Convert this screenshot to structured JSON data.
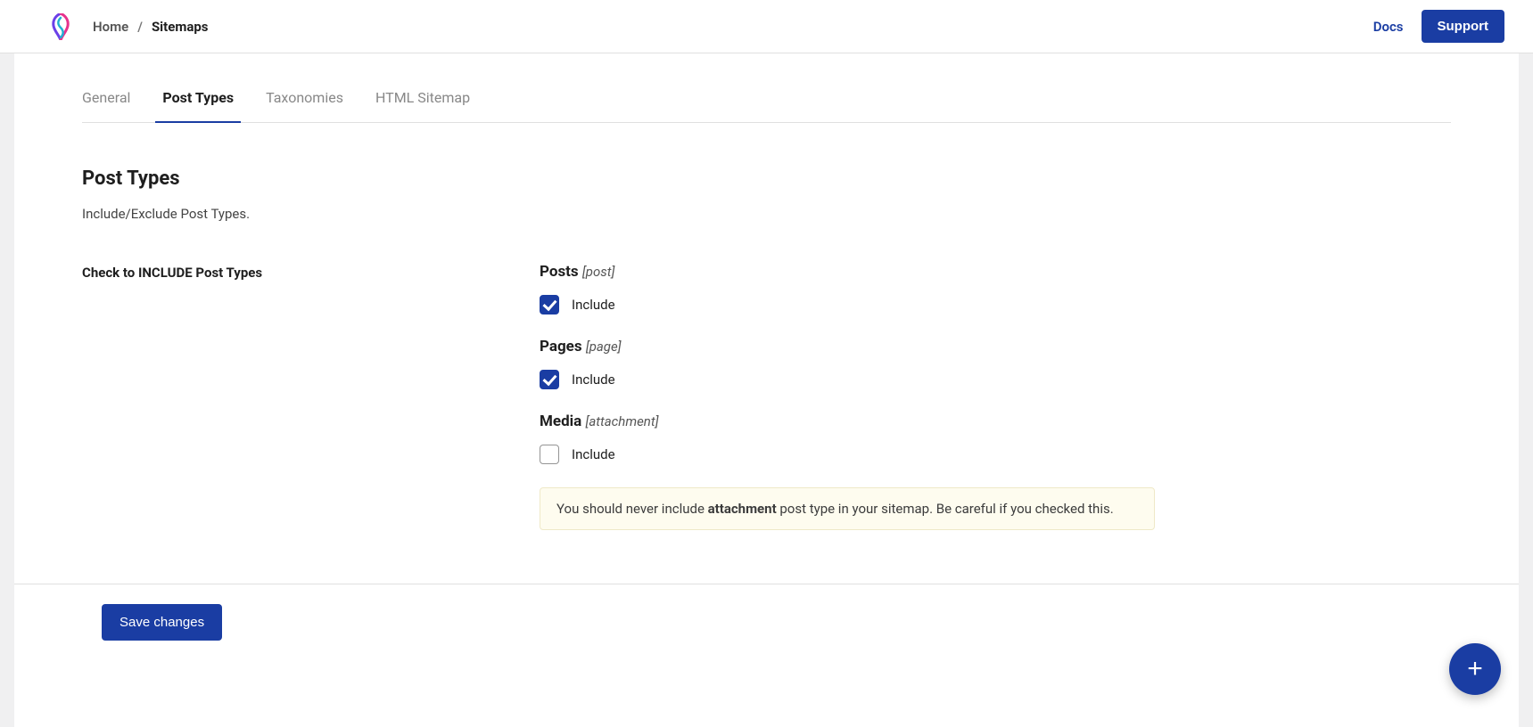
{
  "topbar": {
    "breadcrumb": {
      "home": "Home",
      "sep": "/",
      "current": "Sitemaps"
    },
    "docs": "Docs",
    "support": "Support"
  },
  "tabs": [
    {
      "label": "General",
      "active": false
    },
    {
      "label": "Post Types",
      "active": true
    },
    {
      "label": "Taxonomies",
      "active": false
    },
    {
      "label": "HTML Sitemap",
      "active": false
    }
  ],
  "section": {
    "title": "Post Types",
    "desc": "Include/Exclude Post Types.",
    "row_label": "Check to INCLUDE Post Types"
  },
  "post_types": [
    {
      "title": "Posts",
      "slug": "[post]",
      "include_label": "Include",
      "checked": true
    },
    {
      "title": "Pages",
      "slug": "[page]",
      "include_label": "Include",
      "checked": true
    },
    {
      "title": "Media",
      "slug": "[attachment]",
      "include_label": "Include",
      "checked": false
    }
  ],
  "notice": {
    "pre": "You should never include ",
    "bold": "attachment",
    "post": " post type in your sitemap. Be careful if you checked this."
  },
  "footer": {
    "save": "Save changes"
  },
  "fab": {
    "plus": "+"
  }
}
